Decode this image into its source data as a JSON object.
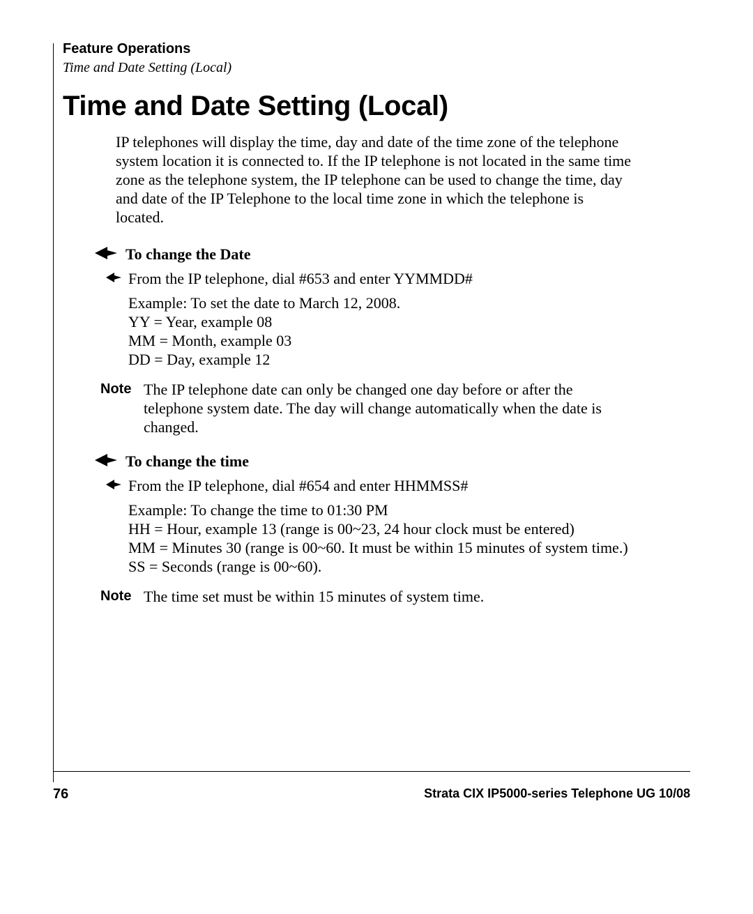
{
  "header": {
    "chapter": "Feature Operations",
    "section": "Time and Date Setting (Local)"
  },
  "title": "Time and Date Setting (Local)",
  "intro": "IP telephones will display the time, day and date of the time zone of the telephone system location it is connected to. If the IP telephone is not located in the same time zone as the telephone system, the IP telephone can be used to change the time, day and date of the IP Telephone to the local time zone in which the telephone is located.",
  "proc1": {
    "heading": "To change the Date",
    "step": "From the IP telephone, dial #653 and enter YYMMDD#",
    "example_title": "Example: To set the date to March 12, 2008.",
    "lines": {
      "yy": "YY = Year, example 08",
      "mm": "MM = Month, example 03",
      "dd": "DD = Day, example 12"
    },
    "note_label": "Note",
    "note": "The IP telephone date can only be changed one day before or after the telephone system date. The day will change automatically when the date is changed."
  },
  "proc2": {
    "heading": "To change the time",
    "step": "From the IP telephone, dial #654 and enter HHMMSS#",
    "example_title": "Example: To change the time to 01:30 PM",
    "lines": {
      "hh": "HH = Hour, example 13 (range is 00~23, 24 hour clock must be entered)",
      "mm": "MM = Minutes 30 (range is 00~60. It must be within 15 minutes of system time.)",
      "ss": "SS = Seconds (range is 00~60)."
    },
    "note_label": "Note",
    "note": "The time set must be within 15 minutes of system time."
  },
  "footer": {
    "page": "76",
    "doc": "Strata CIX IP5000-series Telephone UG    10/08"
  },
  "chart_data": null
}
